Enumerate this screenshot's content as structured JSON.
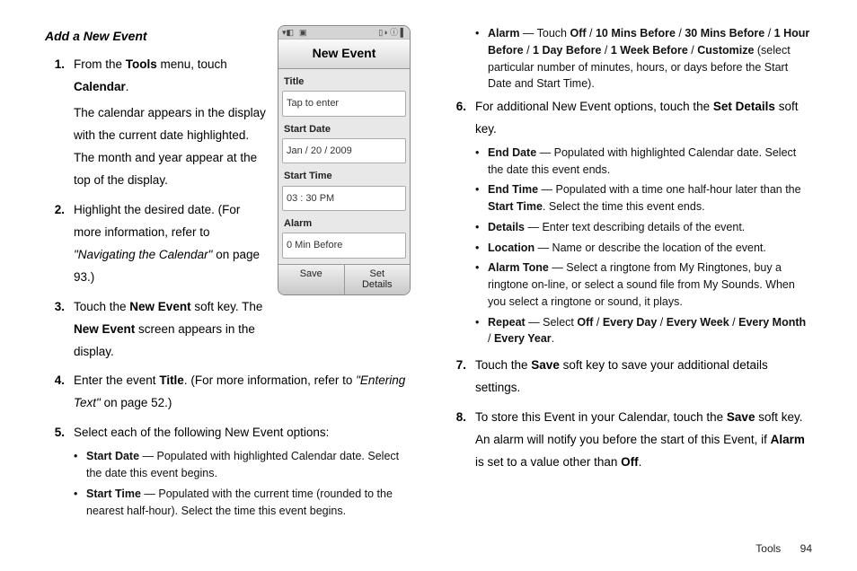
{
  "section_title": "Add a New Event",
  "left": {
    "steps": [
      {
        "num": "1.",
        "html": "From the <b>Tools</b> menu, touch <b>Calendar</b>.",
        "extra": "The calendar appears in the display with the current date highlighted. The month and year appear at the top of the display."
      },
      {
        "num": "2.",
        "html": "Highlight the desired date. (For more information, refer to <i class=\"ref\">\"Navigating the Calendar\"</i> on page 93.)"
      },
      {
        "num": "3.",
        "html": "Touch the <b>New Event</b> soft key. The <b>New Event</b> screen appears in the display."
      },
      {
        "num": "4.",
        "html": "Enter the event <b>Title</b>. (For more information, refer to <i class=\"ref\">\"Entering Text\"</i>  on page 52.)"
      },
      {
        "num": "5.",
        "html": "Select each of the following New Event options:",
        "bullets": [
          "<b>Start Date</b> — Populated with highlighted Calendar date. Select the date this event begins.",
          "<b>Start Time</b> — Populated with the current time (rounded to the nearest half-hour). Select the time this event begins."
        ]
      }
    ]
  },
  "right": {
    "top_bullets": [
      "<b>Alarm</b> — Touch <b>Off</b> / <b>10 Mins Before</b> / <b>30 Mins Before</b> / <b>1 Hour Before</b> / <b>1 Day Before</b> / <b>1 Week Before</b> / <b>Customize</b> (select particular number of minutes, hours, or days before the Start Date and Start Time)."
    ],
    "steps": [
      {
        "num": "6.",
        "html": "For additional New Event options, touch the <b>Set Details</b> soft key.",
        "bullets": [
          "<b>End Date</b> — Populated with highlighted Calendar date. Select the date this event ends.",
          "<b>End Time</b> — Populated with a time one half-hour later than the <b>Start Time</b>. Select the time this event ends.",
          "<b>Details</b> — Enter text describing details of the event.",
          "<b>Location</b> — Name or describe the location of the event.",
          "<b>Alarm Tone</b> — Select a ringtone from My Ringtones, buy a ringtone on-line, or select a sound file from My Sounds. When you select a ringtone or sound, it plays.",
          "<b>Repeat</b> — Select <b>Off</b> / <b>Every Day</b> / <b>Every Week</b> / <b>Every Month</b> / <b>Every Year</b>."
        ]
      },
      {
        "num": "7.",
        "html": "Touch the <b>Save</b> soft key to save your additional details settings."
      },
      {
        "num": "8.",
        "html": "To store this Event in your Calendar, touch the <b>Save</b> soft key. An alarm will notify you before the start of this Event, if <b>Alarm</b> is set to a value other than <b>Off</b>."
      }
    ]
  },
  "phone": {
    "header": "New Event",
    "labels": {
      "title": "Title",
      "start_date": "Start Date",
      "start_time": "Start Time",
      "alarm": "Alarm"
    },
    "fields": {
      "title": "Tap to enter",
      "start_date": "Jan / 20 / 2009",
      "start_time": "03 : 30 PM",
      "alarm": "0 Min Before"
    },
    "softkeys": {
      "left": "Save",
      "right": "Set\nDetails"
    }
  },
  "footer": {
    "section": "Tools",
    "page": "94"
  }
}
